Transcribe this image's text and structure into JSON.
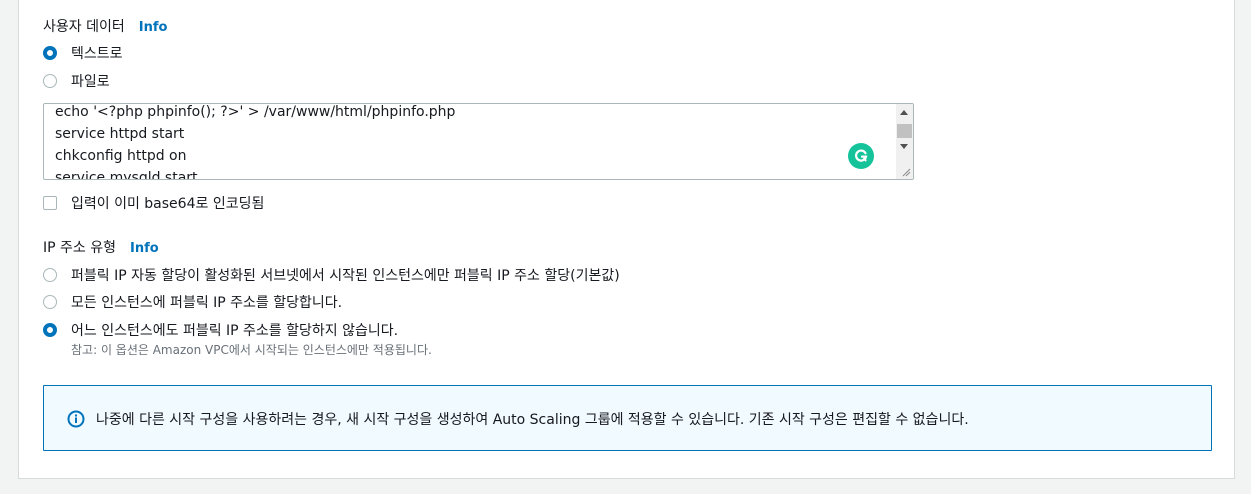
{
  "user_data": {
    "label": "사용자 데이터",
    "info": "Info",
    "options": [
      {
        "label": "텍스트로",
        "selected": true
      },
      {
        "label": "파일로",
        "selected": false
      }
    ],
    "script_lines": [
      "echo '<?php phpinfo(); ?>' > /var/www/html/phpinfo.php",
      "service httpd start",
      "chkconfig httpd on",
      "service mysqld start"
    ],
    "base64_checkbox_label": "입력이 이미 base64로 인코딩됨"
  },
  "ip_address_type": {
    "label": "IP 주소 유형",
    "info": "Info",
    "options": [
      {
        "label": "퍼블릭 IP 자동 할당이 활성화된 서브넷에서 시작된 인스턴스에만 퍼블릭 IP 주소 할당(기본값)",
        "selected": false
      },
      {
        "label": "모든 인스턴스에 퍼블릭 IP 주소를 할당합니다.",
        "selected": false
      },
      {
        "label": "어느 인스턴스에도 퍼블릭 IP 주소를 할당하지 않습니다.",
        "selected": true
      }
    ],
    "note": "참고: 이 옵션은 Amazon VPC에서 시작되는 인스턴스에만 적용됩니다."
  },
  "alert": {
    "message": "나중에 다른 시작 구성을 사용하려는 경우, 새 시작 구성을 생성하여 Auto Scaling 그룹에 적용할 수 있습니다. 기존 시작 구성은 편집할 수 없습니다."
  },
  "colors": {
    "accent": "#0073bb",
    "grammarly": "#15c39a"
  }
}
